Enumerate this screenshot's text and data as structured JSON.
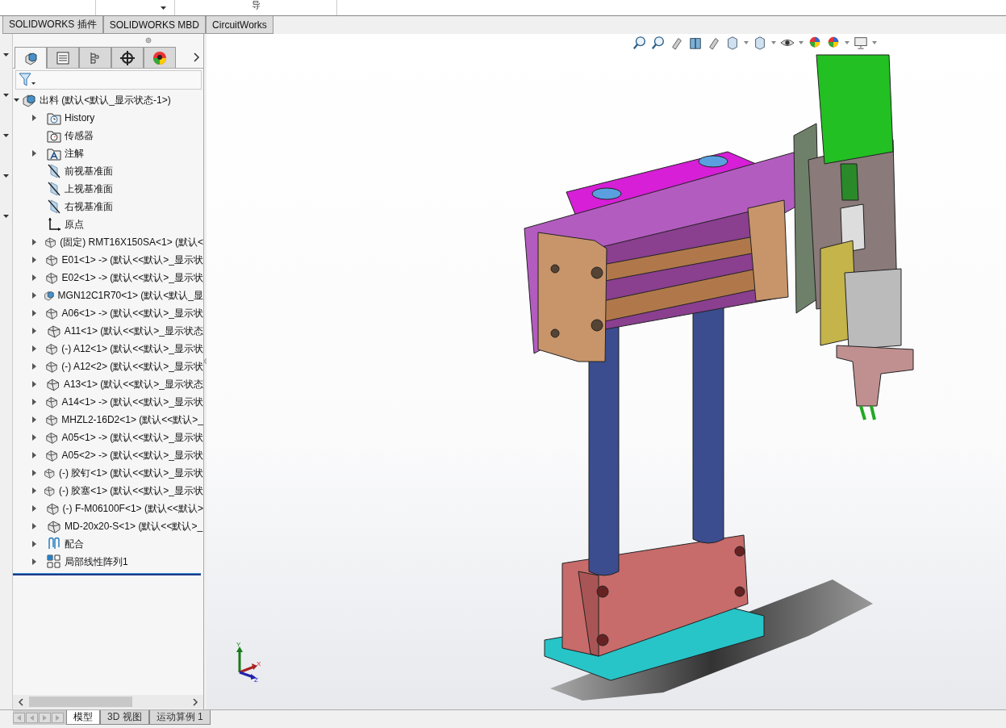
{
  "top_strip": {
    "cut_label": "导"
  },
  "command_tabs": [
    {
      "label": "SOLIDWORKS 插件",
      "selected": false
    },
    {
      "label": "SOLIDWORKS MBD",
      "selected": false
    },
    {
      "label": "CircuitWorks",
      "selected": false
    }
  ],
  "panel_tabs": [
    {
      "kind": "feature",
      "selected": true
    },
    {
      "kind": "property",
      "selected": false
    },
    {
      "kind": "config",
      "selected": false
    },
    {
      "kind": "dim",
      "selected": false
    },
    {
      "kind": "display",
      "selected": false
    }
  ],
  "tree": {
    "label": "出料  (默认<默认_显示状态-1>)",
    "kind": "assembly",
    "expanded": true,
    "children": [
      {
        "label": "History",
        "kind": "history",
        "collapsible": true
      },
      {
        "label": "传感器",
        "kind": "sensor",
        "collapsible": false
      },
      {
        "label": "注解",
        "kind": "annotation",
        "collapsible": true
      },
      {
        "label": "前视基准面",
        "kind": "plane",
        "collapsible": false
      },
      {
        "label": "上视基准面",
        "kind": "plane",
        "collapsible": false
      },
      {
        "label": "右视基准面",
        "kind": "plane",
        "collapsible": false
      },
      {
        "label": "原点",
        "kind": "origin",
        "collapsible": false
      },
      {
        "label": "(固定) RMT16X150SA<1> (默认<",
        "kind": "part",
        "collapsible": true
      },
      {
        "label": "E01<1> -> (默认<<默认>_显示状",
        "kind": "part",
        "collapsible": true
      },
      {
        "label": "E02<1> -> (默认<<默认>_显示状",
        "kind": "part",
        "collapsible": true
      },
      {
        "label": "MGN12C1R70<1> (默认<默认_显",
        "kind": "assembly",
        "collapsible": true
      },
      {
        "label": "A06<1> -> (默认<<默认>_显示状",
        "kind": "part",
        "collapsible": true
      },
      {
        "label": "A11<1> (默认<<默认>_显示状态",
        "kind": "part",
        "collapsible": true
      },
      {
        "label": "(-) A12<1> (默认<<默认>_显示状",
        "kind": "part",
        "collapsible": true
      },
      {
        "label": "(-) A12<2> (默认<<默认>_显示状",
        "kind": "part",
        "collapsible": true
      },
      {
        "label": "A13<1> (默认<<默认>_显示状态",
        "kind": "part",
        "collapsible": true
      },
      {
        "label": "A14<1> -> (默认<<默认>_显示状",
        "kind": "part",
        "collapsible": true
      },
      {
        "label": "MHZL2-16D2<1> (默认<<默认>_",
        "kind": "part",
        "collapsible": true
      },
      {
        "label": "A05<1> -> (默认<<默认>_显示状",
        "kind": "part",
        "collapsible": true
      },
      {
        "label": "A05<2> -> (默认<<默认>_显示状",
        "kind": "part",
        "collapsible": true
      },
      {
        "label": "(-) 胶钉<1> (默认<<默认>_显示状",
        "kind": "part",
        "collapsible": true
      },
      {
        "label": "(-) 胶塞<1> (默认<<默认>_显示状",
        "kind": "part",
        "collapsible": true
      },
      {
        "label": "(-) F-M06100F<1> (默认<<默认>",
        "kind": "part",
        "collapsible": true
      },
      {
        "label": "MD-20x20-S<1> (默认<<默认>_",
        "kind": "part",
        "collapsible": true
      },
      {
        "label": "配合",
        "kind": "mates",
        "collapsible": true
      },
      {
        "label": "局部线性阵列1",
        "kind": "pattern",
        "collapsible": true
      }
    ]
  },
  "triad": {
    "x": "X",
    "y": "Y",
    "z": "Z"
  },
  "bottom_tabs": [
    {
      "label": "模型",
      "selected": true
    },
    {
      "label": "3D 视图",
      "selected": false
    },
    {
      "label": "运动算例 1",
      "selected": false
    }
  ]
}
